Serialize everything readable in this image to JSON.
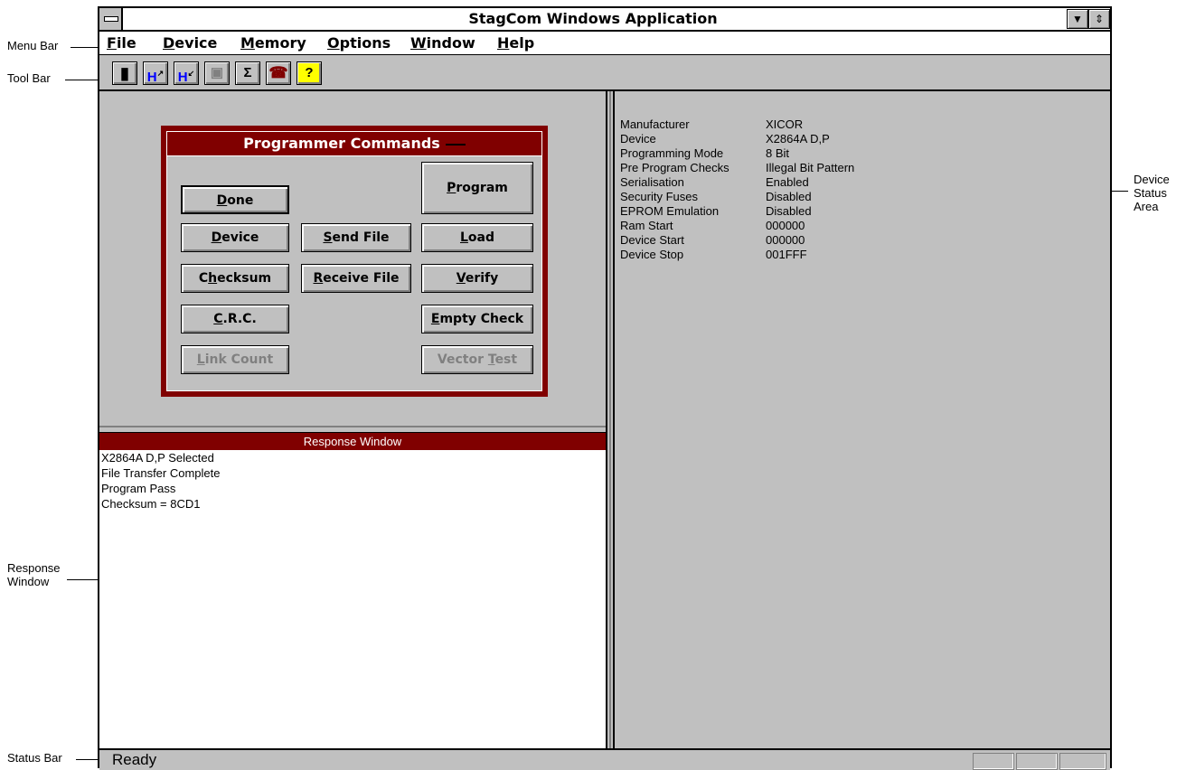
{
  "annotations": {
    "menu_bar": "Menu Bar",
    "tool_bar": "Tool Bar",
    "response_window": [
      "Response",
      "Window"
    ],
    "status_bar": "Status Bar",
    "device_status_area": [
      "Device",
      "Status",
      "Area"
    ]
  },
  "window": {
    "title": "StagCom Windows Application",
    "minimize_glyph": "▼",
    "restore_glyph": "⇕"
  },
  "menu": [
    {
      "label_hot": "F",
      "label_rest": "ile"
    },
    {
      "label_hot": "D",
      "label_rest": "evice"
    },
    {
      "label_hot": "M",
      "label_rest": "emory"
    },
    {
      "label_hot": "O",
      "label_rest": "ptions"
    },
    {
      "label_hot": "W",
      "label_rest": "indow"
    },
    {
      "label_hot": "H",
      "label_rest": "elp"
    }
  ],
  "toolbar": {
    "icons": [
      "chip-icon",
      "save-upload-icon",
      "save-download-icon",
      "lock-icon",
      "sigma-icon",
      "telephone-icon",
      "help-question-icon"
    ],
    "glyphs": [
      "▮",
      "H",
      "H",
      "▣",
      "Σ",
      "☎",
      "?"
    ],
    "colors": {
      "blue": "#0000ff",
      "maroon": "#800000",
      "yellow": "#ffff00"
    }
  },
  "programmer": {
    "title": "Programmer Commands",
    "buttons": {
      "done": {
        "hot": "D",
        "rest": "one",
        "enabled": true,
        "default": true
      },
      "program": {
        "hot": "P",
        "rest": "rogram",
        "enabled": true
      },
      "device": {
        "hot": "D",
        "rest": "evice",
        "enabled": true
      },
      "send_file": {
        "hot": "S",
        "rest": "end File",
        "enabled": true
      },
      "load": {
        "hot": "L",
        "rest": "oad",
        "enabled": true
      },
      "checksum": {
        "pre": "C",
        "hot": "h",
        "rest": "ecksum",
        "enabled": true
      },
      "receive_file": {
        "hot": "R",
        "rest": "eceive File",
        "enabled": true
      },
      "verify": {
        "hot": "V",
        "rest": "erify",
        "enabled": true
      },
      "crc": {
        "hot": "C",
        "rest": ".R.C.",
        "enabled": true
      },
      "empty_check": {
        "hot": "E",
        "rest": "mpty Check",
        "enabled": true
      },
      "link_count": {
        "pre": "",
        "hot": "L",
        "rest": "ink Count",
        "enabled": false
      },
      "vector_test": {
        "pre": "Vector ",
        "hot": "T",
        "rest": "est",
        "enabled": false
      }
    }
  },
  "response": {
    "title": "Response Window",
    "lines": [
      "X2864A D,P Selected",
      "File Transfer Complete",
      "Program Pass",
      "Checksum = 8CD1"
    ]
  },
  "device_status": [
    {
      "label": "Manufacturer",
      "value": "XICOR"
    },
    {
      "label": "Device",
      "value": "X2864A D,P"
    },
    {
      "label": "Programming Mode",
      "value": "8 Bit"
    },
    {
      "label": "Pre Program Checks",
      "value": "Illegal Bit Pattern"
    },
    {
      "label": "Serialisation",
      "value": "Enabled"
    },
    {
      "label": "Security Fuses",
      "value": "Disabled"
    },
    {
      "label": "EPROM Emulation",
      "value": "Disabled"
    },
    {
      "label": "Ram Start",
      "value": "000000"
    },
    {
      "label": "Device Start",
      "value": "000000"
    },
    {
      "label": "Device Stop",
      "value": "001FFF"
    }
  ],
  "statusbar": {
    "text": "Ready"
  }
}
